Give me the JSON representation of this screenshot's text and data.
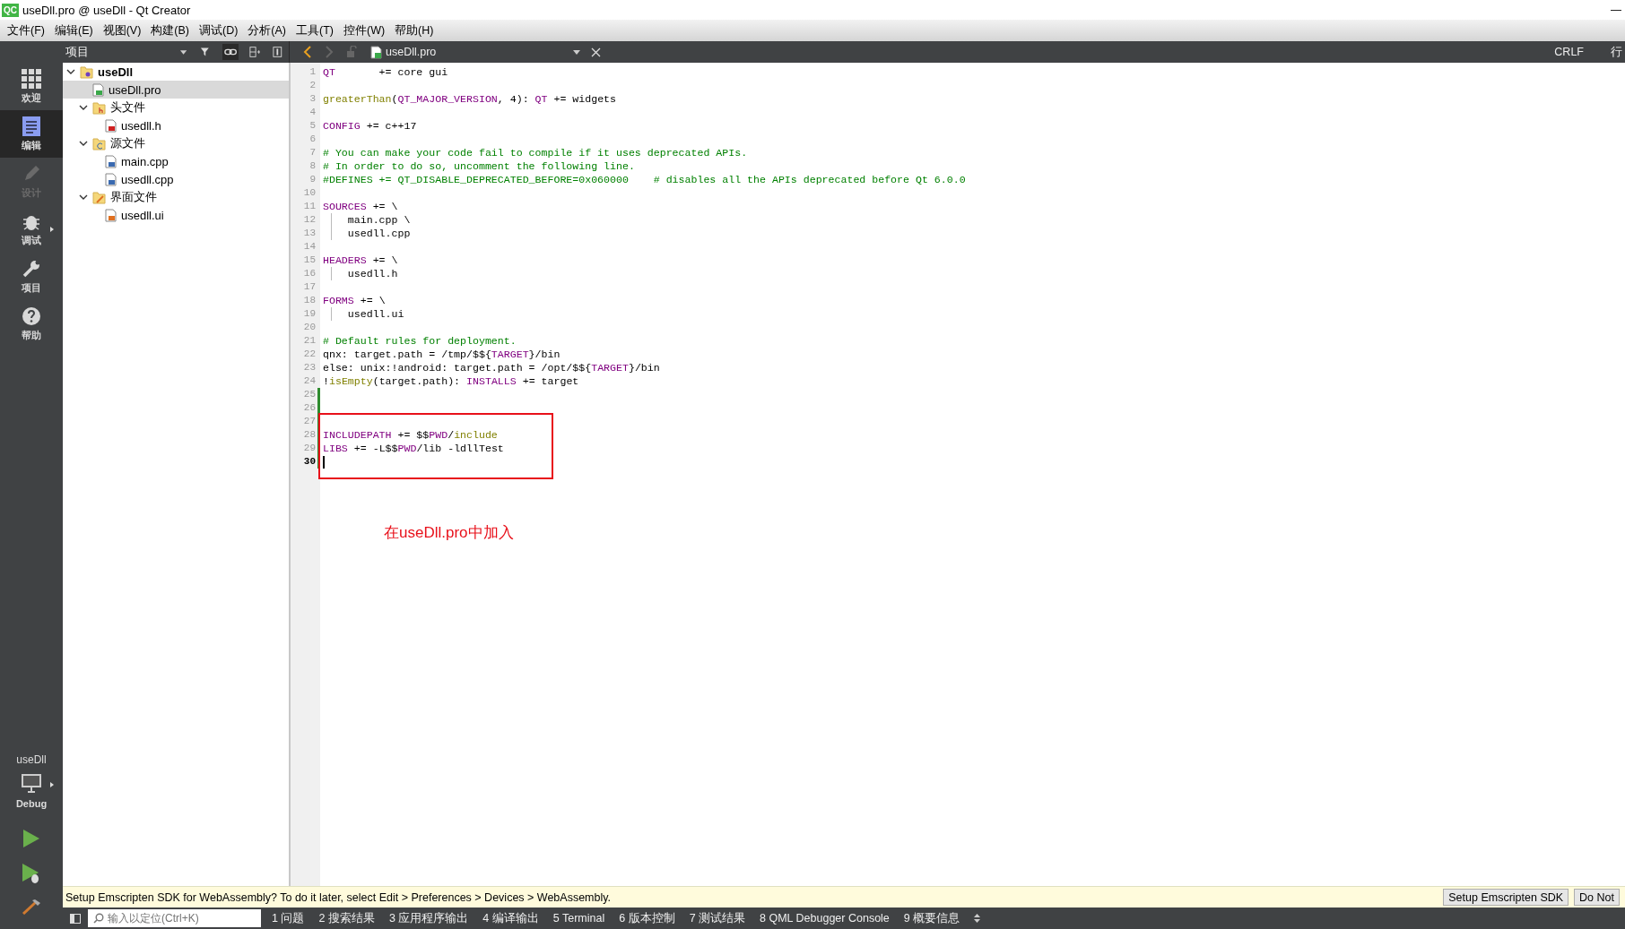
{
  "window": {
    "logo": "QC",
    "title": "useDll.pro @ useDll - Qt Creator",
    "minimize": "—"
  },
  "menu": [
    "文件(F)",
    "编辑(E)",
    "视图(V)",
    "构建(B)",
    "调试(D)",
    "分析(A)",
    "工具(T)",
    "控件(W)",
    "帮助(H)"
  ],
  "mode_bar": {
    "items": [
      {
        "label": "欢迎",
        "kind": "welcome",
        "selected": false,
        "disabled": false,
        "has_menu": false
      },
      {
        "label": "编辑",
        "kind": "edit",
        "selected": true,
        "disabled": false,
        "has_menu": false
      },
      {
        "label": "设计",
        "kind": "design",
        "selected": false,
        "disabled": true,
        "has_menu": false
      },
      {
        "label": "调试",
        "kind": "debug",
        "selected": false,
        "disabled": false,
        "has_menu": true
      },
      {
        "label": "项目",
        "kind": "projects",
        "selected": false,
        "disabled": false,
        "has_menu": false
      },
      {
        "label": "帮助",
        "kind": "help",
        "selected": false,
        "disabled": false,
        "has_menu": false
      }
    ],
    "kit": {
      "project": "useDll",
      "build": "Debug"
    }
  },
  "project_pane": {
    "view": "项目",
    "tree": [
      {
        "label": "useDll",
        "kind": "project",
        "expanded": true,
        "selected": false,
        "children": [
          {
            "label": "useDll.pro",
            "kind": "pro",
            "selected": true
          },
          {
            "label": "头文件",
            "kind": "folder-h",
            "expanded": true,
            "selected": false,
            "children": [
              {
                "label": "usedll.h",
                "kind": "header",
                "selected": false
              }
            ]
          },
          {
            "label": "源文件",
            "kind": "folder-cpp",
            "expanded": true,
            "selected": false,
            "children": [
              {
                "label": "main.cpp",
                "kind": "cpp",
                "selected": false
              },
              {
                "label": "usedll.cpp",
                "kind": "cpp",
                "selected": false
              }
            ]
          },
          {
            "label": "界面文件",
            "kind": "folder-ui",
            "expanded": true,
            "selected": false,
            "children": [
              {
                "label": "usedll.ui",
                "kind": "ui",
                "selected": false
              }
            ]
          }
        ]
      }
    ]
  },
  "editor": {
    "file": "useDll.pro",
    "line_ending": "CRLF",
    "line_info": "行",
    "lines": [
      {
        "number": "1",
        "tokens": [
          {
            "kind": "keyword",
            "text": "QT"
          },
          {
            "kind": "plain",
            "text": "       += core gui"
          }
        ]
      },
      {
        "number": "2"
      },
      {
        "number": "3",
        "tokens": [
          {
            "kind": "function",
            "text": "greaterThan"
          },
          {
            "kind": "plain",
            "text": "("
          },
          {
            "kind": "keyword",
            "text": "QT_MAJOR_VERSION"
          },
          {
            "kind": "plain",
            "text": ", 4): "
          },
          {
            "kind": "keyword",
            "text": "QT"
          },
          {
            "kind": "plain",
            "text": " += widgets"
          }
        ]
      },
      {
        "number": "4"
      },
      {
        "number": "5",
        "tokens": [
          {
            "kind": "keyword",
            "text": "CONFIG"
          },
          {
            "kind": "plain",
            "text": " += c++17"
          }
        ]
      },
      {
        "number": "6"
      },
      {
        "number": "7",
        "tokens": [
          {
            "kind": "comment",
            "text": "# You can make your code fail to compile if it uses deprecated APIs."
          }
        ]
      },
      {
        "number": "8",
        "tokens": [
          {
            "kind": "comment",
            "text": "# In order to do so, uncomment the following line."
          }
        ]
      },
      {
        "number": "9",
        "tokens": [
          {
            "kind": "comment",
            "text": "#DEFINES += QT_DISABLE_DEPRECATED_BEFORE=0x060000    # disables all the APIs deprecated before Qt 6.0.0"
          }
        ]
      },
      {
        "number": "10"
      },
      {
        "number": "11",
        "tokens": [
          {
            "kind": "keyword",
            "text": "SOURCES"
          },
          {
            "kind": "plain",
            "text": " += \\"
          }
        ]
      },
      {
        "number": "12",
        "indent_guide": true,
        "tokens": [
          {
            "kind": "plain",
            "text": "    main.cpp \\"
          }
        ]
      },
      {
        "number": "13",
        "indent_guide": true,
        "tokens": [
          {
            "kind": "plain",
            "text": "    usedll.cpp"
          }
        ]
      },
      {
        "number": "14"
      },
      {
        "number": "15",
        "tokens": [
          {
            "kind": "keyword",
            "text": "HEADERS"
          },
          {
            "kind": "plain",
            "text": " += \\"
          }
        ]
      },
      {
        "number": "16",
        "indent_guide": true,
        "tokens": [
          {
            "kind": "plain",
            "text": "    usedll.h"
          }
        ]
      },
      {
        "number": "17"
      },
      {
        "number": "18",
        "tokens": [
          {
            "kind": "keyword",
            "text": "FORMS"
          },
          {
            "kind": "plain",
            "text": " += \\"
          }
        ]
      },
      {
        "number": "19",
        "indent_guide": true,
        "tokens": [
          {
            "kind": "plain",
            "text": "    usedll.ui"
          }
        ]
      },
      {
        "number": "20"
      },
      {
        "number": "21",
        "tokens": [
          {
            "kind": "comment",
            "text": "# Default rules for deployment."
          }
        ]
      },
      {
        "number": "22",
        "tokens": [
          {
            "kind": "plain",
            "text": "qnx: target.path = /tmp/$${"
          },
          {
            "kind": "keyword",
            "text": "TARGET"
          },
          {
            "kind": "plain",
            "text": "}/bin"
          }
        ]
      },
      {
        "number": "23",
        "tokens": [
          {
            "kind": "plain",
            "text": "else: unix:!android: target.path = /opt/$${"
          },
          {
            "kind": "keyword",
            "text": "TARGET"
          },
          {
            "kind": "plain",
            "text": "}/bin"
          }
        ]
      },
      {
        "number": "24",
        "tokens": [
          {
            "kind": "plain",
            "text": "!"
          },
          {
            "kind": "function",
            "text": "isEmpty"
          },
          {
            "kind": "plain",
            "text": "(target.path): "
          },
          {
            "kind": "keyword",
            "text": "INSTALLS"
          },
          {
            "kind": "plain",
            "text": " += target"
          }
        ]
      },
      {
        "number": "25",
        "modified": true
      },
      {
        "number": "26",
        "modified": true
      },
      {
        "number": "27",
        "modified": true,
        "highlighted": true
      },
      {
        "number": "28",
        "modified": true,
        "highlighted": true,
        "tokens": [
          {
            "kind": "keyword",
            "text": "INCLUDEPATH"
          },
          {
            "kind": "plain",
            "text": " += $$"
          },
          {
            "kind": "keyword",
            "text": "PWD"
          },
          {
            "kind": "plain",
            "text": "/"
          },
          {
            "kind": "function",
            "text": "include"
          }
        ]
      },
      {
        "number": "29",
        "modified": true,
        "highlighted": true,
        "tokens": [
          {
            "kind": "keyword",
            "text": "LIBS"
          },
          {
            "kind": "plain",
            "text": " += -L$$"
          },
          {
            "kind": "keyword",
            "text": "PWD"
          },
          {
            "kind": "plain",
            "text": "/lib -ldllTest"
          }
        ]
      },
      {
        "number": "30",
        "modified": true,
        "highlighted": true,
        "current": true
      }
    ],
    "annotation": "在useDll.pro中加入"
  },
  "info_bar": {
    "message": "Setup Emscripten SDK for WebAssembly? To do it later, select Edit > Preferences > Devices > WebAssembly.",
    "buttons": [
      "Setup Emscripten SDK",
      "Do Not"
    ]
  },
  "status_bar": {
    "locator_placeholder": "输入以定位(Ctrl+K)",
    "panes": [
      "1 问题",
      "2 搜索结果",
      "3 应用程序输出",
      "4 编译输出",
      "5 Terminal",
      "6 版本控制",
      "7 测试结果",
      "8 QML Debugger Console",
      "9 概要信息"
    ]
  }
}
